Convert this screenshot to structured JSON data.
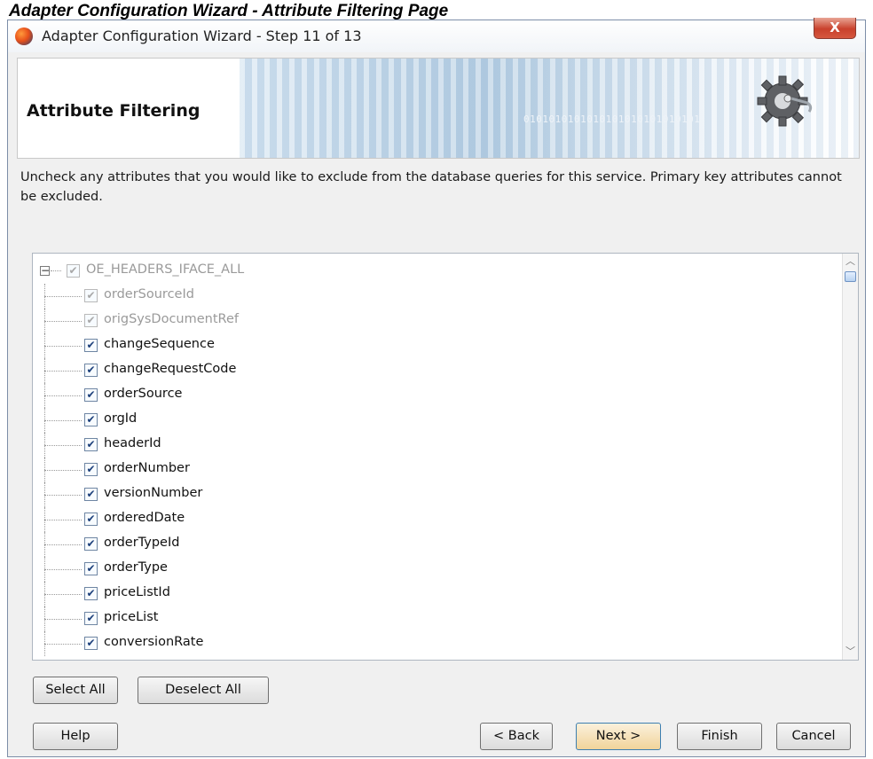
{
  "caption": "Adapter Configuration Wizard - Attribute Filtering Page",
  "window": {
    "title": "Adapter Configuration Wizard - Step 11 of 13",
    "close_label": "X"
  },
  "header": {
    "title": "Attribute Filtering",
    "binary_text": "0101010101010101010101010101"
  },
  "description": "Uncheck any attributes that you would like to exclude from the database queries for this service.  Primary key attributes cannot be excluded.",
  "tree": {
    "root": {
      "label": "OE_HEADERS_IFACE_ALL",
      "checked": true,
      "disabled": true,
      "expander": "−"
    },
    "items": [
      {
        "label": "orderSourceId",
        "checked": true,
        "disabled": true
      },
      {
        "label": "origSysDocumentRef",
        "checked": true,
        "disabled": true
      },
      {
        "label": "changeSequence",
        "checked": true,
        "disabled": false
      },
      {
        "label": "changeRequestCode",
        "checked": true,
        "disabled": false
      },
      {
        "label": "orderSource",
        "checked": true,
        "disabled": false
      },
      {
        "label": "orgId",
        "checked": true,
        "disabled": false
      },
      {
        "label": "headerId",
        "checked": true,
        "disabled": false
      },
      {
        "label": "orderNumber",
        "checked": true,
        "disabled": false
      },
      {
        "label": "versionNumber",
        "checked": true,
        "disabled": false
      },
      {
        "label": "orderedDate",
        "checked": true,
        "disabled": false
      },
      {
        "label": "orderTypeId",
        "checked": true,
        "disabled": false
      },
      {
        "label": "orderType",
        "checked": true,
        "disabled": false
      },
      {
        "label": "priceListId",
        "checked": true,
        "disabled": false
      },
      {
        "label": "priceList",
        "checked": true,
        "disabled": false
      },
      {
        "label": "conversionRate",
        "checked": true,
        "disabled": false
      }
    ],
    "check_glyph": "✔",
    "scroll_up_glyph": "︿",
    "scroll_down_glyph": "﹀"
  },
  "buttons": {
    "select_all": "Select All",
    "deselect_all": "Deselect All",
    "help": "Help",
    "back": "< Back",
    "next": "Next >",
    "finish": "Finish",
    "cancel": "Cancel"
  }
}
